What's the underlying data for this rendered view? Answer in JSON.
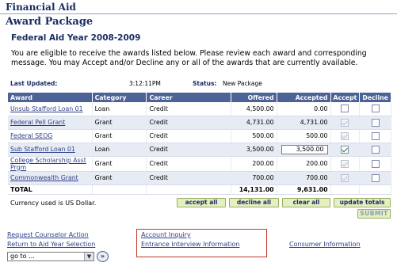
{
  "header": {
    "app_title": "Financial Aid",
    "page_title": "Award Package"
  },
  "aid_year": "Federal Aid Year 2008-2009",
  "intro": "You are eligible to receive the awards listed below. Please review each award and corresponding message. You may Accept and/or Decline any or all of the awards that are currently available.",
  "meta": {
    "last_updated_label": "Last Updated:",
    "last_updated_value": "3:12:11PM",
    "status_label": "Status:",
    "status_value": "New Package"
  },
  "table": {
    "headers": {
      "award": "Award",
      "category": "Category",
      "career": "Career",
      "offered": "Offered",
      "accepted": "Accepted",
      "accept": "Accept",
      "decline": "Decline"
    },
    "rows": [
      {
        "award": "Unsub Stafford Loan 01",
        "category": "Loan",
        "career": "Credit",
        "offered": "4,500.00",
        "accepted": "0.00",
        "accept_checked": false,
        "accept_enabled": true,
        "decline_checked": false
      },
      {
        "award": "Federal Pell Grant",
        "category": "Grant",
        "career": "Credit",
        "offered": "4,731.00",
        "accepted": "4,731.00",
        "accept_checked": true,
        "accept_enabled": false,
        "decline_checked": false
      },
      {
        "award": "Federal SEOG",
        "category": "Grant",
        "career": "Credit",
        "offered": "500.00",
        "accepted": "500.00",
        "accept_checked": true,
        "accept_enabled": false,
        "decline_checked": false
      },
      {
        "award": "Sub Stafford Loan 01",
        "category": "Loan",
        "career": "Credit",
        "offered": "3,500.00",
        "accepted": "3,500.00",
        "accept_checked": true,
        "accept_enabled": true,
        "decline_checked": false
      },
      {
        "award": "College Scholarship Asst Prgm",
        "category": "Grant",
        "career": "Credit",
        "offered": "200.00",
        "accepted": "200.00",
        "accept_checked": true,
        "accept_enabled": false,
        "decline_checked": false
      },
      {
        "award": "Commonwealth Grant",
        "category": "Grant",
        "career": "Credit",
        "offered": "700.00",
        "accepted": "700.00",
        "accept_checked": true,
        "accept_enabled": false,
        "decline_checked": false
      }
    ],
    "total_label": "TOTAL",
    "total_offered": "14,131.00",
    "total_accepted": "9,631.00"
  },
  "currency_note": "Currency used is US Dollar.",
  "buttons": {
    "accept_all": "accept all",
    "decline_all": "decline all",
    "clear_all": "clear all",
    "update_totals": "update totals",
    "submit": "SUBMIT"
  },
  "links": {
    "request_counselor": "Request Counselor Action",
    "return_aid_year": "Return to Aid Year Selection",
    "account_inquiry": "Account Inquiry",
    "entrance_interview": "Entrance Interview Information",
    "consumer_info": "Consumer Information"
  },
  "goto": {
    "selected": "go to ...",
    "button": "»"
  },
  "colors": {
    "header_bg": "#4d6296",
    "title": "#1b2d63",
    "link": "#2d3f8a",
    "button_bg": "#e4efc2",
    "highlight": "#c0392b"
  }
}
